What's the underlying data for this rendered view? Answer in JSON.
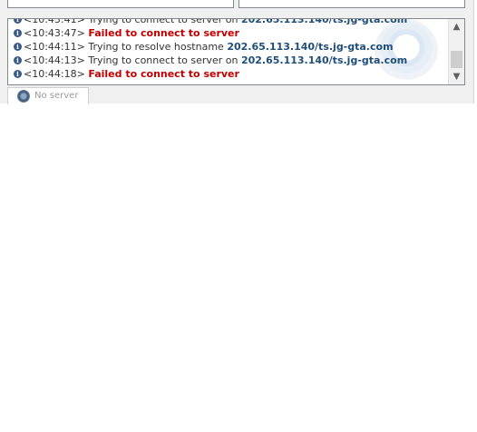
{
  "log": {
    "lines": [
      {
        "timestamp": "<10:43:41>",
        "message": "Trying to connect to server on",
        "host": "202.65.113.140/ts.jg-gta.com",
        "error": ""
      },
      {
        "timestamp": "<10:43:47>",
        "message": "",
        "host": "",
        "error": "Failed to connect to server"
      },
      {
        "timestamp": "<10:44:11>",
        "message": "Trying to resolve hostname",
        "host": "202.65.113.140/ts.jg-gta.com",
        "error": ""
      },
      {
        "timestamp": "<10:44:13>",
        "message": "Trying to connect to server on",
        "host": "202.65.113.140/ts.jg-gta.com",
        "error": ""
      },
      {
        "timestamp": "<10:44:18>",
        "message": "",
        "host": "",
        "error": "Failed to connect to server"
      }
    ],
    "info_icon_glyph": "i"
  },
  "scrollbar": {
    "up_arrow": "▲",
    "down_arrow": "▼"
  },
  "tabs": [
    {
      "label": "No server",
      "icon": "server-status-icon"
    }
  ],
  "colors": {
    "error": "#c00000",
    "host": "#1f4e79",
    "panel_bg": "#f0f0f0"
  }
}
